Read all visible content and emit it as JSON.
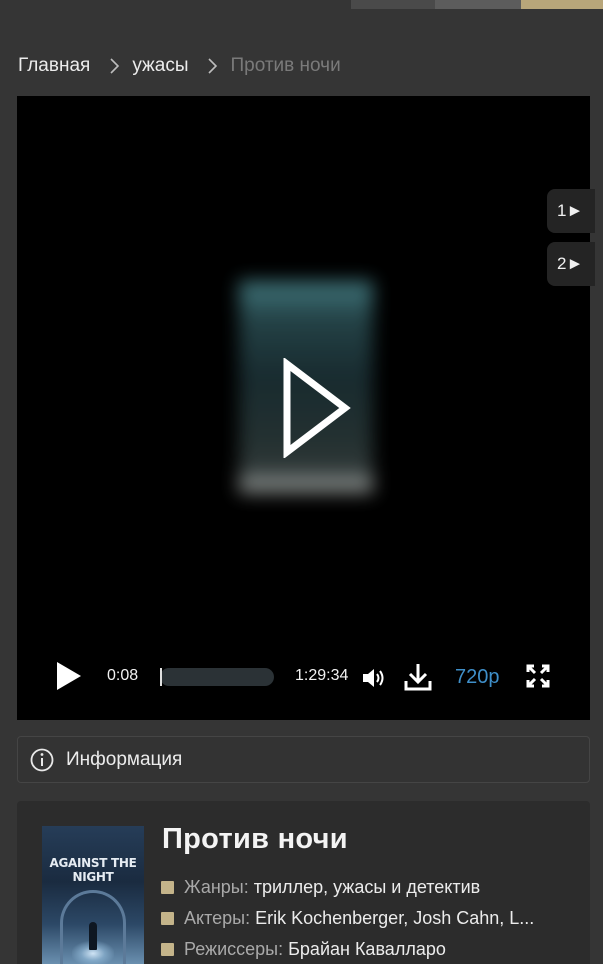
{
  "breadcrumb": {
    "home": "Главная",
    "category": "ужасы",
    "current": "Против ночи"
  },
  "player": {
    "current_time": "0:08",
    "total_time": "1:29:34",
    "progress_fraction": 0.0015,
    "quality": "720p",
    "side_buttons": [
      "1►",
      "2►"
    ]
  },
  "info": {
    "label": "Информация"
  },
  "movie": {
    "title": "Против ночи",
    "poster_text": "AGAINST THE NIGHT",
    "genres_key": "Жанры:",
    "genres_value": "триллер, ужасы и детектив",
    "actors_key": "Актеры:",
    "actors_value": "Erik Kochenberger, Josh Cahn, L...",
    "directors_key": "Режиссеры:",
    "directors_value": "Брайан Кавалларо"
  },
  "colors": {
    "accent_gold": "#c4b48a",
    "quality_blue": "#3f8fc9",
    "background": "#353535"
  }
}
